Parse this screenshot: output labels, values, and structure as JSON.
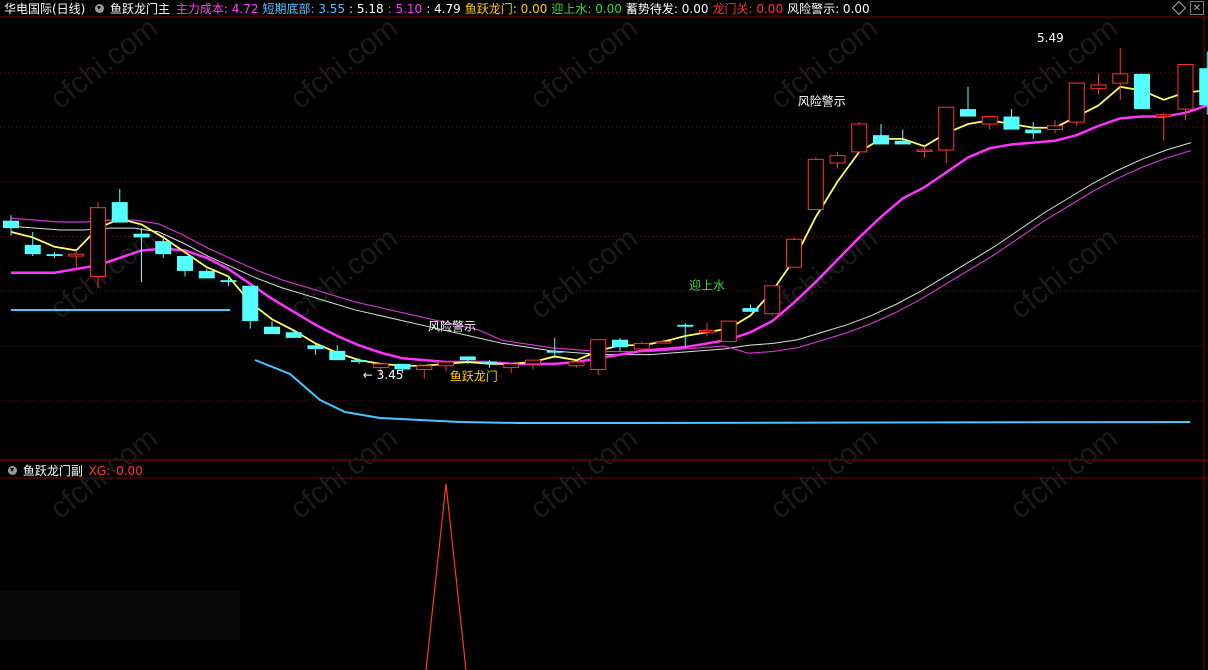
{
  "main_header": {
    "stock": "华电国际(日线)",
    "indicator": "鱼跃龙门主",
    "items": [
      {
        "label": "主力成本: ",
        "value": "4.72",
        "color": "#ff3cff"
      },
      {
        "label": "短期底部: ",
        "value": "3.55",
        "color": "#4fc3ff"
      },
      {
        "label": ": ",
        "value": "5.18",
        "color": "#ffffff"
      },
      {
        "label": ": ",
        "value": "5.10",
        "color": "#ff3cff"
      },
      {
        "label": ": ",
        "value": "4.79",
        "color": "#ffffff"
      },
      {
        "label": "鱼跃龙门: ",
        "value": "0.00",
        "color": "#ffcc00"
      },
      {
        "label": "迎上水: ",
        "value": "0.00",
        "color": "#33dd33"
      },
      {
        "label": "蓄势待发: ",
        "value": "0.00",
        "color": "#ffffff"
      },
      {
        "label": "龙门关: ",
        "value": "0.00",
        "color": "#ff3333"
      },
      {
        "label": "风险警示: ",
        "value": "0.00",
        "color": "#ffffff"
      }
    ]
  },
  "sub_header": {
    "indicator": "鱼跃龙门副",
    "label": "XG: ",
    "value": "0.00",
    "color": "#ff3333"
  },
  "chart_data": {
    "type": "candlestick",
    "title": "",
    "ylim": [
      3.3,
      5.65
    ],
    "candles": [
      {
        "o": 4.56,
        "h": 4.59,
        "l": 4.48,
        "c": 4.52
      },
      {
        "o": 4.43,
        "h": 4.5,
        "l": 4.37,
        "c": 4.38
      },
      {
        "o": 4.38,
        "h": 4.39,
        "l": 4.36,
        "c": 4.37
      },
      {
        "o": 4.37,
        "h": 4.4,
        "l": 4.3,
        "c": 4.38
      },
      {
        "o": 4.26,
        "h": 4.66,
        "l": 4.2,
        "c": 4.63
      },
      {
        "o": 4.66,
        "h": 4.73,
        "l": 4.55,
        "c": 4.55
      },
      {
        "o": 4.49,
        "h": 4.52,
        "l": 4.23,
        "c": 4.47
      },
      {
        "o": 4.45,
        "h": 4.48,
        "l": 4.36,
        "c": 4.38
      },
      {
        "o": 4.37,
        "h": 4.37,
        "l": 4.26,
        "c": 4.29
      },
      {
        "o": 4.29,
        "h": 4.3,
        "l": 4.25,
        "c": 4.25
      },
      {
        "o": 4.24,
        "h": 4.26,
        "l": 4.21,
        "c": 4.23
      },
      {
        "o": 4.21,
        "h": 4.21,
        "l": 3.98,
        "c": 4.02
      },
      {
        "o": 3.99,
        "h": 4.02,
        "l": 3.95,
        "c": 3.95
      },
      {
        "o": 3.96,
        "h": 3.97,
        "l": 3.93,
        "c": 3.93
      },
      {
        "o": 3.89,
        "h": 3.9,
        "l": 3.84,
        "c": 3.87
      },
      {
        "o": 3.86,
        "h": 3.89,
        "l": 3.81,
        "c": 3.81
      },
      {
        "o": 3.81,
        "h": 3.82,
        "l": 3.79,
        "c": 3.8
      },
      {
        "o": 3.77,
        "h": 3.79,
        "l": 3.73,
        "c": 3.79
      },
      {
        "o": 3.79,
        "h": 3.79,
        "l": 3.74,
        "c": 3.76
      },
      {
        "o": 3.76,
        "h": 3.78,
        "l": 3.71,
        "c": 3.78
      },
      {
        "o": 3.78,
        "h": 3.8,
        "l": 3.75,
        "c": 3.8
      },
      {
        "o": 3.83,
        "h": 3.83,
        "l": 3.79,
        "c": 3.81
      },
      {
        "o": 3.8,
        "h": 3.81,
        "l": 3.77,
        "c": 3.79
      },
      {
        "o": 3.77,
        "h": 3.79,
        "l": 3.74,
        "c": 3.79
      },
      {
        "o": 3.79,
        "h": 3.81,
        "l": 3.76,
        "c": 3.81
      },
      {
        "o": 3.86,
        "h": 3.93,
        "l": 3.82,
        "c": 3.85
      },
      {
        "o": 3.78,
        "h": 3.8,
        "l": 3.77,
        "c": 3.8
      },
      {
        "o": 3.76,
        "h": 3.91,
        "l": 3.73,
        "c": 3.92
      },
      {
        "o": 3.92,
        "h": 3.93,
        "l": 3.86,
        "c": 3.88
      },
      {
        "o": 3.87,
        "h": 3.91,
        "l": 3.85,
        "c": 3.9
      },
      {
        "o": 3.91,
        "h": 3.92,
        "l": 3.9,
        "c": 3.91
      },
      {
        "o": 4.0,
        "h": 4.01,
        "l": 3.88,
        "c": 3.99
      },
      {
        "o": 3.96,
        "h": 4.01,
        "l": 3.94,
        "c": 3.97
      },
      {
        "o": 3.91,
        "h": 4.02,
        "l": 3.91,
        "c": 4.02
      },
      {
        "o": 4.09,
        "h": 4.11,
        "l": 4.07,
        "c": 4.07
      },
      {
        "o": 4.06,
        "h": 4.16,
        "l": 4.05,
        "c": 4.21
      },
      {
        "o": 4.31,
        "h": 4.47,
        "l": 4.31,
        "c": 4.46
      },
      {
        "o": 4.62,
        "h": 4.9,
        "l": 4.62,
        "c": 4.89
      },
      {
        "o": 4.87,
        "h": 4.93,
        "l": 4.84,
        "c": 4.91
      },
      {
        "o": 4.93,
        "h": 5.09,
        "l": 4.92,
        "c": 5.08
      },
      {
        "o": 5.02,
        "h": 5.08,
        "l": 4.98,
        "c": 4.97
      },
      {
        "o": 4.99,
        "h": 5.05,
        "l": 4.97,
        "c": 4.97
      },
      {
        "o": 4.94,
        "h": 4.96,
        "l": 4.9,
        "c": 4.94
      },
      {
        "o": 4.94,
        "h": 5.17,
        "l": 4.87,
        "c": 5.17
      },
      {
        "o": 5.16,
        "h": 5.28,
        "l": 5.12,
        "c": 5.12
      },
      {
        "o": 5.08,
        "h": 5.12,
        "l": 5.05,
        "c": 5.12
      },
      {
        "o": 5.12,
        "h": 5.16,
        "l": 5.06,
        "c": 5.05
      },
      {
        "o": 5.05,
        "h": 5.09,
        "l": 5.0,
        "c": 5.03
      },
      {
        "o": 5.05,
        "h": 5.1,
        "l": 5.03,
        "c": 5.07
      },
      {
        "o": 5.09,
        "h": 5.3,
        "l": 5.07,
        "c": 5.3
      },
      {
        "o": 5.27,
        "h": 5.35,
        "l": 5.24,
        "c": 5.29
      },
      {
        "o": 5.3,
        "h": 5.49,
        "l": 5.21,
        "c": 5.35
      },
      {
        "o": 5.35,
        "h": 5.35,
        "l": 5.17,
        "c": 5.16
      },
      {
        "o": 5.12,
        "h": 5.14,
        "l": 4.99,
        "c": 5.13
      },
      {
        "o": 5.16,
        "h": 5.4,
        "l": 5.1,
        "c": 5.4
      },
      {
        "o": 5.38,
        "h": 5.47,
        "l": 5.13,
        "c": 5.18
      }
    ],
    "ma_yellow": [
      4.5,
      4.47,
      4.42,
      4.4,
      4.52,
      4.57,
      4.54,
      4.47,
      4.39,
      4.31,
      4.26,
      4.12,
      4.03,
      3.97,
      3.9,
      3.85,
      3.81,
      3.79,
      3.78,
      3.78,
      3.79,
      3.8,
      3.79,
      3.79,
      3.8,
      3.83,
      3.81,
      3.86,
      3.89,
      3.89,
      3.91,
      3.94,
      3.96,
      3.98,
      4.05,
      4.18,
      4.35,
      4.58,
      4.77,
      4.93,
      5.0,
      5.0,
      4.96,
      5.03,
      5.08,
      5.1,
      5.08,
      5.06,
      5.06,
      5.12,
      5.18,
      5.28,
      5.26,
      5.21,
      5.25,
      5.26
    ],
    "ma_magenta": [
      4.28,
      4.28,
      4.28,
      4.3,
      4.32,
      4.36,
      4.4,
      4.41,
      4.4,
      4.36,
      4.3,
      4.22,
      4.14,
      4.07,
      4.0,
      3.94,
      3.89,
      3.85,
      3.82,
      3.81,
      3.8,
      3.8,
      3.8,
      3.79,
      3.79,
      3.79,
      3.8,
      3.82,
      3.84,
      3.86,
      3.87,
      3.88,
      3.9,
      3.92,
      3.96,
      4.02,
      4.12,
      4.23,
      4.35,
      4.47,
      4.58,
      4.68,
      4.74,
      4.82,
      4.9,
      4.95,
      4.97,
      4.98,
      4.99,
      5.02,
      5.07,
      5.11,
      5.12,
      5.12,
      5.14,
      5.18
    ],
    "ma_white": [
      4.53,
      4.52,
      4.51,
      4.51,
      4.52,
      4.52,
      4.5,
      4.44,
      4.37,
      4.31,
      4.25,
      4.2,
      4.16,
      4.12,
      4.08,
      4.05,
      4.02,
      3.99,
      3.96,
      3.93,
      3.9,
      3.88,
      3.86,
      3.85,
      3.84,
      3.84,
      3.84,
      3.85,
      3.86,
      3.87,
      3.89,
      3.9,
      3.92,
      3.96,
      4.0,
      4.05,
      4.11,
      4.18,
      4.26,
      4.34,
      4.42,
      4.51,
      4.6,
      4.68,
      4.76,
      4.83,
      4.89,
      4.94,
      4.98
    ],
    "ma_white_start": 0,
    "support_line": {
      "level": 3.8,
      "value_label": "3.55"
    },
    "annotations": [
      {
        "text": "风险警示",
        "index": 20,
        "price": 3.97,
        "color": "#ffffff"
      },
      {
        "text": "鱼跃龙门",
        "index": 21,
        "price": 3.7,
        "color": "#ffcc00"
      },
      {
        "text": "迎上水",
        "index": 32,
        "price": 4.19,
        "color": "#33dd33"
      },
      {
        "text": "风险警示",
        "index": 37,
        "price": 5.18,
        "color": "#ffffff"
      },
      {
        "text": "← 3.45",
        "index": 17,
        "price": 3.71,
        "color": "#ffffff"
      },
      {
        "text": "5.49",
        "index": 48,
        "price": 5.52,
        "color": "#ffffff"
      }
    ],
    "sub_series": {
      "name": "XG",
      "spike_index": 20,
      "spike_value": 1,
      "color": "#ff3333"
    }
  },
  "watermark": "cfchi.com",
  "colors": {
    "up": "#ff3333",
    "down": "#54ffff",
    "ma_yellow": "#ffff66",
    "ma_magenta": "#ff33ff",
    "ma_white": "#dddddd",
    "ma_purple": "#cc33cc",
    "support": "#45c8ff",
    "grid": "#7a0000"
  }
}
